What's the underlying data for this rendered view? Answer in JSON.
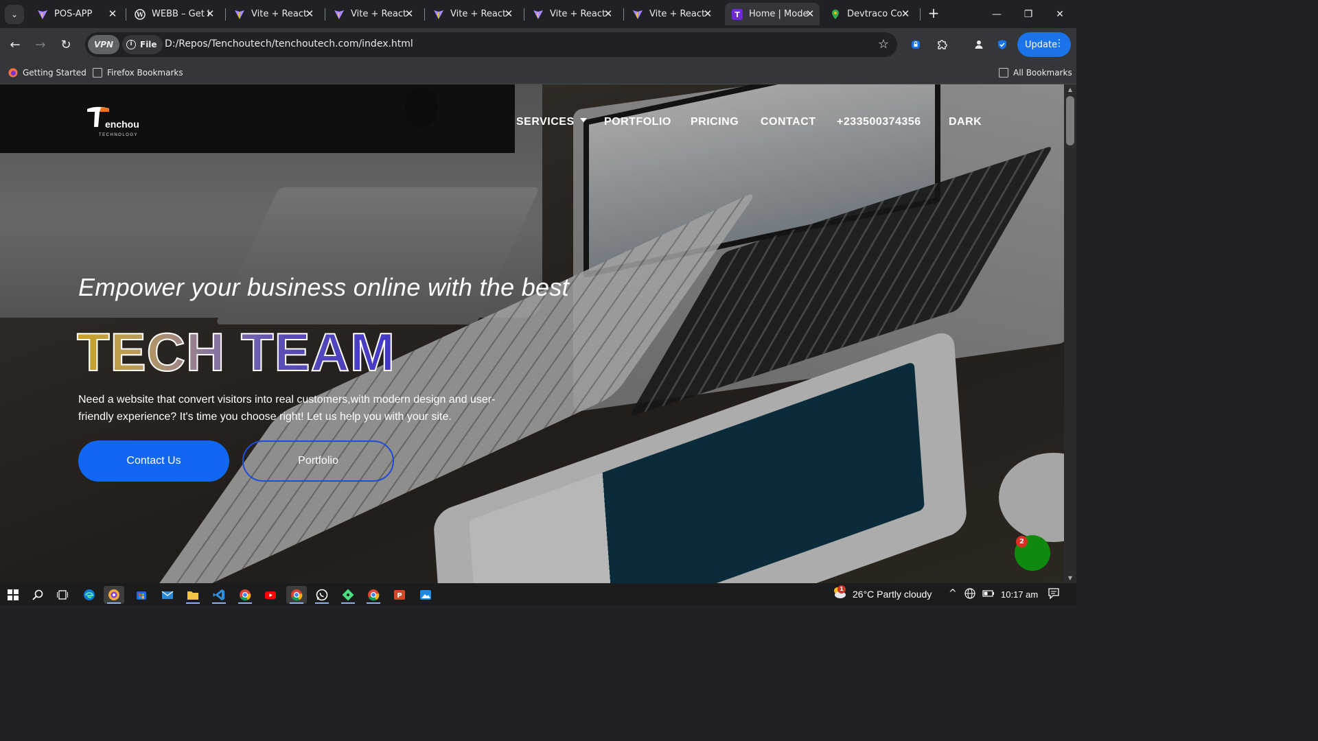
{
  "browser": {
    "tabs": [
      {
        "title": "POS-APP",
        "favicon": "vite-icon",
        "active": false
      },
      {
        "title": "WEBB – Get i",
        "favicon": "wordpress-icon",
        "active": false
      },
      {
        "title": "Vite + React",
        "favicon": "vite-icon",
        "active": false
      },
      {
        "title": "Vite + React",
        "favicon": "vite-icon",
        "active": false
      },
      {
        "title": "Vite + React",
        "favicon": "vite-icon",
        "active": false
      },
      {
        "title": "Vite + React",
        "favicon": "vite-icon",
        "active": false
      },
      {
        "title": "Vite + React",
        "favicon": "vite-icon",
        "active": false
      },
      {
        "title": "Home | Mode",
        "favicon": "site-t-icon",
        "active": true
      },
      {
        "title": "Devtraco Co",
        "favicon": "maps-pin-icon",
        "active": false
      }
    ],
    "vpn_label": "VPN",
    "file_label": "File",
    "url": "D:/Repos/Tenchoutech/tenchoutech.com/index.html",
    "update_label": "Update",
    "bookmarks": [
      {
        "label": "Getting Started",
        "icon": "firefox-icon"
      },
      {
        "label": "Firefox Bookmarks",
        "icon": "folder-icon"
      }
    ],
    "all_bookmarks_label": "All Bookmarks"
  },
  "site": {
    "logo": {
      "name": "enchou",
      "tagline": "TECHNOLOGY"
    },
    "nav": {
      "services": "SERVICES",
      "portfolio": "PORTFOLIO",
      "pricing": "PRICING",
      "contact": "CONTACT",
      "phone": "+233500374356",
      "dark": "DARK"
    },
    "hero": {
      "subtitle": "Empower your business online with the best",
      "title": "TECH TEAM",
      "description": "Need a website that convert visitors into real customers,with modern design and user-friendly experience? It's time you choose right! Let us help you with your site.",
      "contact_button": "Contact Us",
      "portfolio_button": "Portfolio"
    },
    "chat": {
      "badge_count": "2"
    },
    "colors": {
      "primary": "#1167f2",
      "title_gold": "#c9a227",
      "title_indigo": "#4238c8",
      "chat_green": "#0f8a0f"
    }
  },
  "taskbar": {
    "weather": "26°C  Partly cloudy",
    "weather_badge": "1",
    "time": "10:17 am"
  }
}
